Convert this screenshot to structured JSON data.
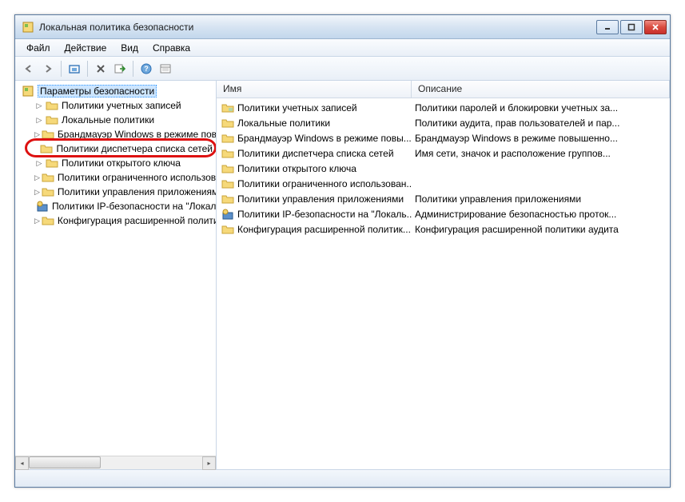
{
  "window": {
    "title": "Локальная политика безопасности"
  },
  "menu": {
    "file": "Файл",
    "action": "Действие",
    "view": "Вид",
    "help": "Справка"
  },
  "tree": {
    "root": "Параметры безопасности",
    "items": [
      "Политики учетных записей",
      "Локальные политики",
      "Брандмауэр Windows в режиме повышенной безопасности",
      "Политики диспетчера списка сетей",
      "Политики открытого ключа",
      "Политики ограниченного использования программ",
      "Политики управления приложениями",
      "Политики IP-безопасности на \"Локальный компьютер\"",
      "Конфигурация расширенной политики аудита"
    ]
  },
  "list": {
    "columns": {
      "name": "Имя",
      "desc": "Описание"
    },
    "rows": [
      {
        "name": "Политики учетных записей",
        "desc": "Политики паролей и блокировки учетных за...",
        "icon": "policy"
      },
      {
        "name": "Локальные политики",
        "desc": "Политики аудита, прав пользователей и пар...",
        "icon": "folder"
      },
      {
        "name": "Брандмауэр Windows в режиме повы...",
        "desc": "Брандмауэр Windows в режиме повышенно...",
        "icon": "folder"
      },
      {
        "name": "Политики диспетчера списка сетей",
        "desc": "Имя сети, значок и расположение группов...",
        "icon": "folder"
      },
      {
        "name": "Политики открытого ключа",
        "desc": "",
        "icon": "folder"
      },
      {
        "name": "Политики ограниченного использован...",
        "desc": "",
        "icon": "folder"
      },
      {
        "name": "Политики управления приложениями",
        "desc": "Политики управления приложениями",
        "icon": "folder"
      },
      {
        "name": "Политики IP-безопасности на \"Локаль...",
        "desc": "Администрирование безопасностью проток...",
        "icon": "ipsec"
      },
      {
        "name": "Конфигурация расширенной политик...",
        "desc": "Конфигурация расширенной политики аудита",
        "icon": "folder"
      }
    ]
  }
}
